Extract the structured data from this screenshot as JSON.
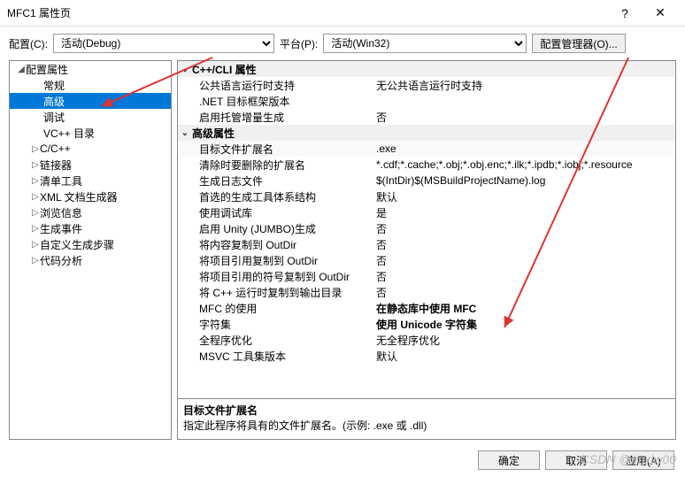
{
  "titlebar": {
    "title": "MFC1 属性页",
    "help": "?",
    "close": "✕"
  },
  "toolbar": {
    "config_label": "配置(C):",
    "config_value": "活动(Debug)",
    "platform_label": "平台(P):",
    "platform_value": "活动(Win32)",
    "manager_label": "配置管理器(O)..."
  },
  "tree": {
    "root": "配置属性",
    "items": [
      {
        "label": "常规",
        "leaf": true
      },
      {
        "label": "高级",
        "leaf": true,
        "selected": true
      },
      {
        "label": "调试",
        "leaf": true
      },
      {
        "label": "VC++ 目录",
        "leaf": true
      },
      {
        "label": "C/C++",
        "leaf": false
      },
      {
        "label": "链接器",
        "leaf": false
      },
      {
        "label": "清单工具",
        "leaf": false
      },
      {
        "label": "XML 文档生成器",
        "leaf": false
      },
      {
        "label": "浏览信息",
        "leaf": false
      },
      {
        "label": "生成事件",
        "leaf": false
      },
      {
        "label": "自定义生成步骤",
        "leaf": false
      },
      {
        "label": "代码分析",
        "leaf": false
      }
    ]
  },
  "grid": {
    "section1": "C++/CLI 属性",
    "rows1": [
      {
        "k": "公共语言运行时支持",
        "v": "无公共语言运行时支持"
      },
      {
        "k": ".NET 目标框架版本",
        "v": ""
      },
      {
        "k": "启用托管增量生成",
        "v": "否"
      }
    ],
    "section2": "高级属性",
    "rows2": [
      {
        "k": "目标文件扩展名",
        "v": ".exe",
        "sel": true
      },
      {
        "k": "清除时要删除的扩展名",
        "v": "*.cdf;*.cache;*.obj;*.obj.enc;*.ilk;*.ipdb;*.iobj;*.resource"
      },
      {
        "k": "生成日志文件",
        "v": "$(IntDir)$(MSBuildProjectName).log"
      },
      {
        "k": "首选的生成工具体系结构",
        "v": "默认"
      },
      {
        "k": "使用调试库",
        "v": "是"
      },
      {
        "k": "启用 Unity (JUMBO)生成",
        "v": "否"
      },
      {
        "k": "将内容复制到 OutDir",
        "v": "否"
      },
      {
        "k": "将项目引用复制到 OutDir",
        "v": "否"
      },
      {
        "k": "将项目引用的符号复制到 OutDir",
        "v": "否"
      },
      {
        "k": "将 C++ 运行时复制到输出目录",
        "v": "否"
      },
      {
        "k": "MFC 的使用",
        "v": "在静态库中使用 MFC",
        "bold": true
      },
      {
        "k": "字符集",
        "v": "使用 Unicode 字符集",
        "bold": true
      },
      {
        "k": "全程序优化",
        "v": "无全程序优化"
      },
      {
        "k": "MSVC 工具集版本",
        "v": "默认"
      }
    ]
  },
  "desc": {
    "title": "目标文件扩展名",
    "text": "指定此程序将具有的文件扩展名。(示例: .exe 或 .dll)"
  },
  "footer": {
    "ok": "确定",
    "cancel": "取消",
    "apply": "应用(A)"
  },
  "watermark": "CSDN @imxlw00"
}
